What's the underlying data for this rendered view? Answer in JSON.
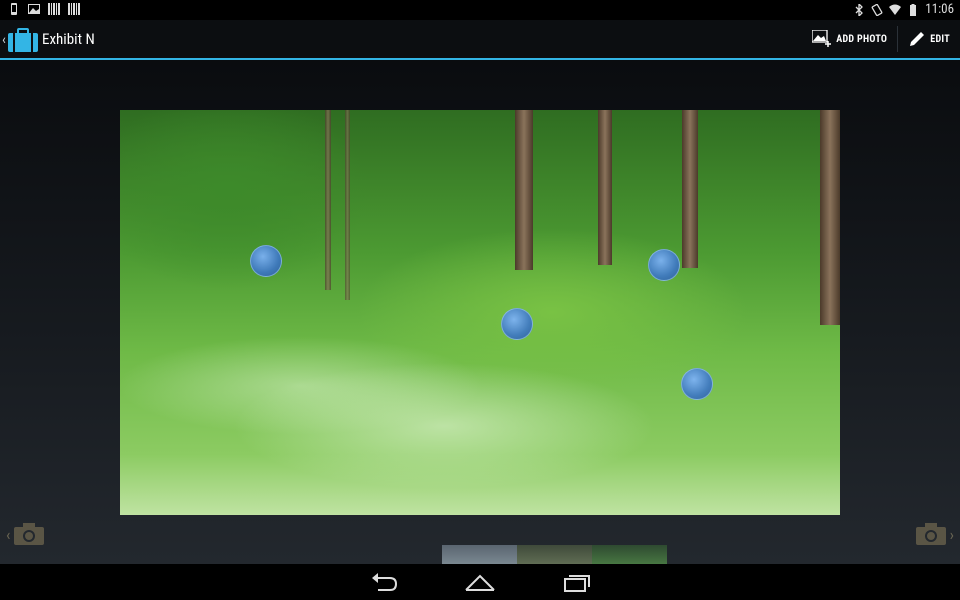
{
  "status_bar": {
    "time": "11:06",
    "left_icons": [
      "phone-icon",
      "image-icon",
      "barcode-icon",
      "barcode-icon"
    ],
    "right_icons": [
      "bluetooth-icon",
      "rotate-icon",
      "wifi-icon",
      "battery-icon"
    ]
  },
  "action_bar": {
    "title": "Exhibit N",
    "add_photo_label": "ADD PHOTO",
    "edit_label": "EDIT",
    "accent_color": "#33b5e5"
  },
  "photo": {
    "description_icon": "forest-photo",
    "markers": 4
  },
  "thumbnails": {
    "count": 3
  },
  "system_nav": {
    "buttons": [
      "back-icon",
      "home-icon",
      "recents-icon"
    ]
  }
}
